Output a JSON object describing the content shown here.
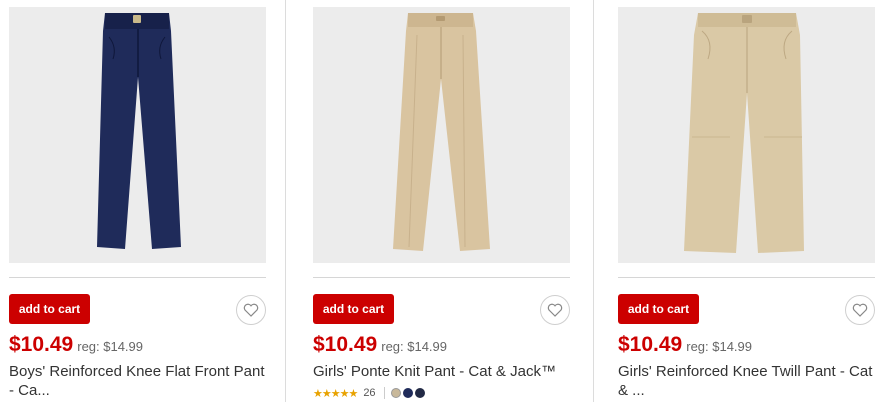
{
  "colors": {
    "accent": "#cc0000",
    "navy_pant": "#1f2b5a",
    "khaki_pant": "#d9c4a0",
    "khaki_pant_2": "#dac9a6"
  },
  "products": [
    {
      "button_label": "add to cart",
      "price": "$10.49",
      "reg_price": "reg: $14.99",
      "title_line1": "Boys' Reinforced Knee Flat Front Pant",
      "title_line2": "- Ca...",
      "image_icon": "navy-pants-image",
      "favorite_icon": "heart-icon"
    },
    {
      "button_label": "add to cart",
      "price": "$10.49",
      "reg_price": "reg: $14.99",
      "title_line1": "Girls' Ponte Knit Pant - Cat & Jack™",
      "title_line2": "",
      "rating_stars": "★★★★★",
      "rating_value": 4.5,
      "rating_count": "26",
      "swatches": [
        "#c8b89a",
        "#1f2b5a",
        "#222a45"
      ],
      "image_icon": "khaki-pants-image",
      "favorite_icon": "heart-icon"
    },
    {
      "button_label": "add to cart",
      "price": "$10.49",
      "reg_price": "reg: $14.99",
      "title_line1": "Girls' Reinforced Knee Twill Pant - Cat",
      "title_line2": "& ...",
      "image_icon": "khaki-twill-pants-image",
      "favorite_icon": "heart-icon"
    }
  ]
}
